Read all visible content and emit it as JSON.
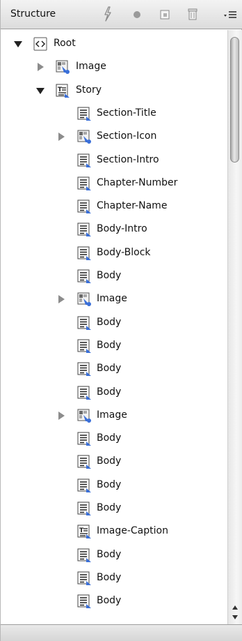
{
  "panel": {
    "title": "Structure",
    "toolbar_icons": [
      "lightning-icon",
      "record-dot-icon",
      "new-element-icon",
      "trash-icon",
      "panel-menu-icon"
    ]
  },
  "tree": {
    "rows": [
      {
        "label": "Root",
        "depth": 0,
        "toggle": "expanded",
        "icon": "root-tag-icon"
      },
      {
        "label": "Image",
        "depth": 1,
        "toggle": "collapsed",
        "icon": "image-element-icon"
      },
      {
        "label": "Story",
        "depth": 1,
        "toggle": "expanded",
        "icon": "story-element-icon"
      },
      {
        "label": "Section-Title",
        "depth": 2,
        "toggle": "none",
        "icon": "paragraph-element-icon"
      },
      {
        "label": "Section-Icon",
        "depth": 2,
        "toggle": "collapsed",
        "icon": "image-element-icon"
      },
      {
        "label": "Section-Intro",
        "depth": 2,
        "toggle": "none",
        "icon": "paragraph-element-icon"
      },
      {
        "label": "Chapter-Number",
        "depth": 2,
        "toggle": "none",
        "icon": "paragraph-element-icon"
      },
      {
        "label": "Chapter-Name",
        "depth": 2,
        "toggle": "none",
        "icon": "paragraph-element-icon"
      },
      {
        "label": "Body-Intro",
        "depth": 2,
        "toggle": "none",
        "icon": "paragraph-element-icon"
      },
      {
        "label": "Body-Block",
        "depth": 2,
        "toggle": "none",
        "icon": "paragraph-element-icon"
      },
      {
        "label": "Body",
        "depth": 2,
        "toggle": "none",
        "icon": "paragraph-element-icon"
      },
      {
        "label": "Image",
        "depth": 2,
        "toggle": "collapsed",
        "icon": "image-element-icon"
      },
      {
        "label": "Body",
        "depth": 2,
        "toggle": "none",
        "icon": "paragraph-element-icon"
      },
      {
        "label": "Body",
        "depth": 2,
        "toggle": "none",
        "icon": "paragraph-element-icon"
      },
      {
        "label": "Body",
        "depth": 2,
        "toggle": "none",
        "icon": "paragraph-element-icon"
      },
      {
        "label": "Body",
        "depth": 2,
        "toggle": "none",
        "icon": "paragraph-element-icon"
      },
      {
        "label": "Image",
        "depth": 2,
        "toggle": "collapsed",
        "icon": "image-element-icon"
      },
      {
        "label": "Body",
        "depth": 2,
        "toggle": "none",
        "icon": "paragraph-element-icon"
      },
      {
        "label": "Body",
        "depth": 2,
        "toggle": "none",
        "icon": "paragraph-element-icon"
      },
      {
        "label": "Body",
        "depth": 2,
        "toggle": "none",
        "icon": "paragraph-element-icon"
      },
      {
        "label": "Body",
        "depth": 2,
        "toggle": "none",
        "icon": "paragraph-element-icon"
      },
      {
        "label": "Image-Caption",
        "depth": 2,
        "toggle": "none",
        "icon": "story-element-icon"
      },
      {
        "label": "Body",
        "depth": 2,
        "toggle": "none",
        "icon": "paragraph-element-icon"
      },
      {
        "label": "Body",
        "depth": 2,
        "toggle": "none",
        "icon": "paragraph-element-icon"
      },
      {
        "label": "Body",
        "depth": 2,
        "toggle": "none",
        "icon": "paragraph-element-icon"
      }
    ]
  },
  "scrollbar": {
    "icons": [
      "scroll-up-arrow-icon",
      "scroll-down-arrow-icon"
    ]
  },
  "colors": {
    "header_bg": "#e4e4e4",
    "icon_blue": "#3a6fd8",
    "text": "#111111"
  }
}
